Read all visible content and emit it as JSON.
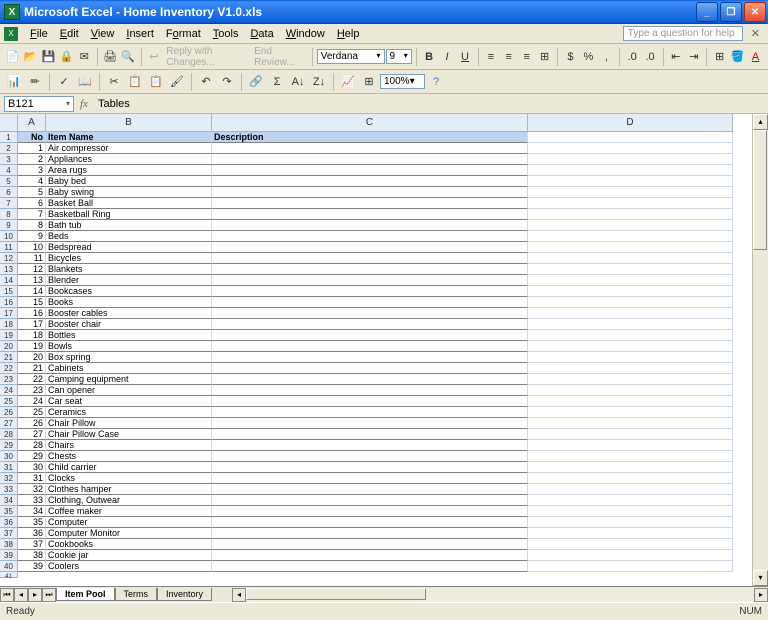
{
  "titlebar": {
    "app": "Microsoft Excel",
    "file": "Home Inventory V1.0.xls"
  },
  "menu": {
    "file": "File",
    "edit": "Edit",
    "view": "View",
    "insert": "Insert",
    "format": "Format",
    "tools": "Tools",
    "data": "Data",
    "window": "Window",
    "help": "Help",
    "helpbox": "Type a question for help"
  },
  "toolbar": {
    "reply": "Reply with Changes...",
    "endreview": "End Review...",
    "font": "Verdana",
    "size": "9",
    "zoom": "100%"
  },
  "namebox": {
    "cell": "B121",
    "formula": "Tables"
  },
  "columns": {
    "A": "A",
    "B": "B",
    "C": "C",
    "D": "D"
  },
  "headers": {
    "no": "No",
    "item": "Item Name",
    "desc": "Description"
  },
  "rows": [
    {
      "n": "1",
      "name": "Air compressor"
    },
    {
      "n": "2",
      "name": "Appliances"
    },
    {
      "n": "3",
      "name": "Area rugs"
    },
    {
      "n": "4",
      "name": "Baby bed"
    },
    {
      "n": "5",
      "name": "Baby swing"
    },
    {
      "n": "6",
      "name": "Basket Ball"
    },
    {
      "n": "7",
      "name": "Basketball Ring"
    },
    {
      "n": "8",
      "name": "Bath tub"
    },
    {
      "n": "9",
      "name": "Beds"
    },
    {
      "n": "10",
      "name": "Bedspread"
    },
    {
      "n": "11",
      "name": "Bicycles"
    },
    {
      "n": "12",
      "name": "Blankets"
    },
    {
      "n": "13",
      "name": "Blender"
    },
    {
      "n": "14",
      "name": "Bookcases"
    },
    {
      "n": "15",
      "name": "Books"
    },
    {
      "n": "16",
      "name": "Booster cables"
    },
    {
      "n": "17",
      "name": "Booster chair"
    },
    {
      "n": "18",
      "name": "Bottles"
    },
    {
      "n": "19",
      "name": "Bowls"
    },
    {
      "n": "20",
      "name": "Box spring"
    },
    {
      "n": "21",
      "name": "Cabinets"
    },
    {
      "n": "22",
      "name": "Camping equipment"
    },
    {
      "n": "23",
      "name": "Can opener"
    },
    {
      "n": "24",
      "name": "Car seat"
    },
    {
      "n": "25",
      "name": "Ceramics"
    },
    {
      "n": "26",
      "name": "Chair Pillow"
    },
    {
      "n": "27",
      "name": "Chair Pillow Case"
    },
    {
      "n": "28",
      "name": "Chairs"
    },
    {
      "n": "29",
      "name": "Chests"
    },
    {
      "n": "30",
      "name": "Child carrier"
    },
    {
      "n": "31",
      "name": "Clocks"
    },
    {
      "n": "32",
      "name": "Clothes hamper"
    },
    {
      "n": "33",
      "name": "Clothing, Outwear"
    },
    {
      "n": "34",
      "name": "Coffee maker"
    },
    {
      "n": "35",
      "name": "Computer"
    },
    {
      "n": "36",
      "name": "Computer Monitor"
    },
    {
      "n": "37",
      "name": "Cookbooks"
    },
    {
      "n": "38",
      "name": "Cookie jar"
    },
    {
      "n": "39",
      "name": "Coolers"
    }
  ],
  "tabs": {
    "t1": "Item Pool",
    "t2": "Terms",
    "t3": "Inventory"
  },
  "status": {
    "ready": "Ready",
    "num": "NUM"
  }
}
